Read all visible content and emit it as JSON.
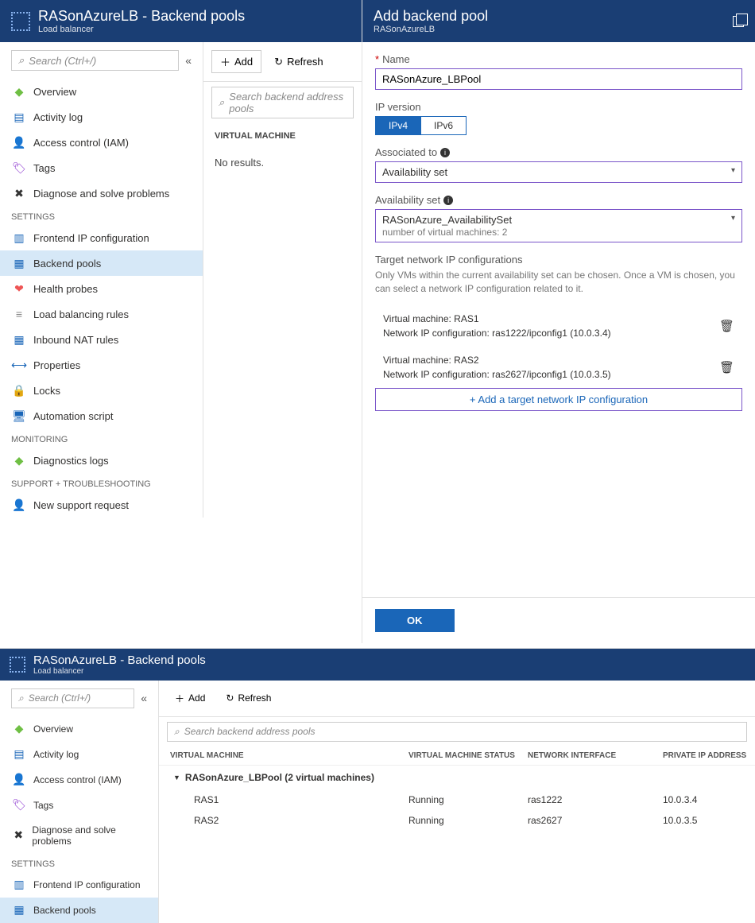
{
  "top": {
    "title": "RASonAzureLB - Backend pools",
    "subtitle": "Load balancer"
  },
  "search": {
    "placeholder": "Search (Ctrl+/)"
  },
  "nav": {
    "items": [
      {
        "label": "Overview",
        "icon": "◆",
        "color": "#6fbf44"
      },
      {
        "label": "Activity log",
        "icon": "▤",
        "color": "#1a66b8"
      },
      {
        "label": "Access control (IAM)",
        "icon": "👤",
        "color": "#1a66b8"
      },
      {
        "label": "Tags",
        "icon": "🏷",
        "color": "#8e3bd0"
      },
      {
        "label": "Diagnose and solve problems",
        "icon": "✖",
        "color": "#333"
      }
    ],
    "settings_label": "SETTINGS",
    "settings": [
      {
        "label": "Frontend IP configuration",
        "icon": "▥",
        "color": "#1a66b8"
      },
      {
        "label": "Backend pools",
        "icon": "▦",
        "color": "#1a66b8",
        "selected": true
      },
      {
        "label": "Health probes",
        "icon": "❤",
        "color": "#e55"
      },
      {
        "label": "Load balancing rules",
        "icon": "≡",
        "color": "#888"
      },
      {
        "label": "Inbound NAT rules",
        "icon": "▦",
        "color": "#1a66b8"
      },
      {
        "label": "Properties",
        "icon": "⟷",
        "color": "#1a66b8"
      },
      {
        "label": "Locks",
        "icon": "🔒",
        "color": "#333"
      },
      {
        "label": "Automation script",
        "icon": "🖥",
        "color": "#1a66b8"
      }
    ],
    "monitoring_label": "MONITORING",
    "monitoring": [
      {
        "label": "Diagnostics logs",
        "icon": "◆",
        "color": "#6fbf44"
      }
    ],
    "support_label": "SUPPORT + TROUBLESHOOTING",
    "support": [
      {
        "label": "New support request",
        "icon": "👤",
        "color": "#1a66b8"
      }
    ]
  },
  "middle": {
    "add": "Add",
    "refresh": "Refresh",
    "search_placeholder": "Search backend address pools",
    "col_vm": "VIRTUAL MACHINE",
    "noresults": "No results."
  },
  "panel": {
    "title": "Add backend pool",
    "subtitle": "RASonAzureLB",
    "name_label": "Name",
    "name_value": "RASonAzure_LBPool",
    "ipver_label": "IP version",
    "ipv4": "IPv4",
    "ipv6": "IPv6",
    "assoc_label": "Associated to",
    "assoc_value": "Availability set",
    "avail_label": "Availability set",
    "avail_line1": "RASonAzure_AvailabilitySet",
    "avail_line2": "number of virtual machines: 2",
    "target_label": "Target network IP configurations",
    "target_desc": "Only VMs within the current availability set can be chosen. Once a VM is chosen, you can select a network IP configuration related to it.",
    "configs": [
      {
        "vm": "Virtual machine: RAS1",
        "ip": "Network IP configuration: ras1222/ipconfig1 (10.0.3.4)"
      },
      {
        "vm": "Virtual machine: RAS2",
        "ip": "Network IP configuration: ras2627/ipconfig1 (10.0.3.5)"
      }
    ],
    "add_link": "+ Add a target network IP configuration",
    "ok": "OK"
  },
  "bottom": {
    "title": "RASonAzureLB - Backend pools",
    "subtitle": "Load balancer",
    "cols": {
      "vm": "VIRTUAL MACHINE",
      "status": "VIRTUAL MACHINE STATUS",
      "nic": "NETWORK INTERFACE",
      "ip": "PRIVATE IP ADDRESS"
    },
    "group": "RASonAzure_LBPool (2 virtual machines)",
    "rows": [
      {
        "vm": "RAS1",
        "status": "Running",
        "nic": "ras1222",
        "ip": "10.0.3.4"
      },
      {
        "vm": "RAS2",
        "status": "Running",
        "nic": "ras2627",
        "ip": "10.0.3.5"
      }
    ]
  }
}
